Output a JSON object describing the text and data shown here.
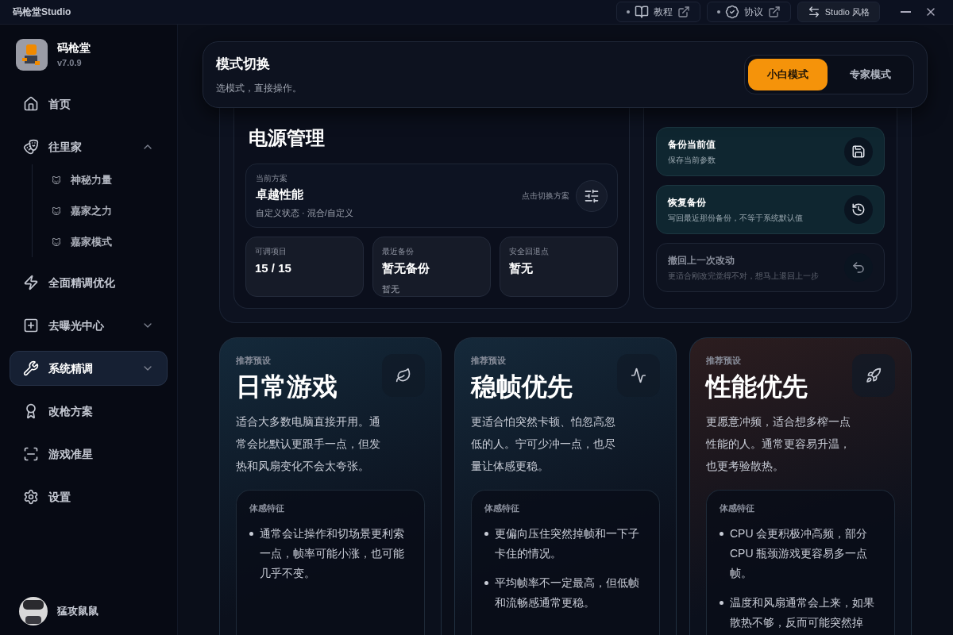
{
  "titlebar": {
    "title": "码枪堂Studio",
    "links": [
      {
        "label": "教程"
      },
      {
        "label": "协议"
      }
    ],
    "style_button": {
      "label": "Studio 风格"
    }
  },
  "sidebar": {
    "brand": {
      "name": "码枪堂",
      "version": "v7.0.9"
    },
    "items": [
      {
        "label": "首页",
        "selected": false
      },
      {
        "label": "往里家",
        "selected": false,
        "expanded": true,
        "children": [
          {
            "label": "神秘力量"
          },
          {
            "label": "嘉家之力"
          },
          {
            "label": "嘉家模式"
          }
        ]
      },
      {
        "label": "全面精调优化",
        "selected": false
      },
      {
        "label": "去曝光中心",
        "selected": false,
        "expanded": false
      },
      {
        "label": "系统精调",
        "selected": true,
        "expanded": false
      },
      {
        "label": "改枪方案",
        "selected": false
      },
      {
        "label": "游戏准星",
        "selected": false
      },
      {
        "label": "设置",
        "selected": false
      }
    ],
    "user": {
      "name": "猛攻鼠鼠"
    }
  },
  "mode_switch": {
    "title": "模式切换",
    "subtitle": "选模式，直接操作。",
    "options": [
      {
        "label": "小白模式",
        "selected": true
      },
      {
        "label": "专家模式",
        "selected": false
      }
    ]
  },
  "power": {
    "title": "电源管理",
    "current_plan": {
      "label": "当前方案",
      "name": "卓越性能",
      "detail": "自定义状态 · 混合/自定义",
      "hint": "点击切换方案"
    },
    "stats": [
      {
        "label": "可调项目",
        "value": "15 / 15"
      },
      {
        "label": "最近备份",
        "value": "暂无备份",
        "note": "暂无"
      },
      {
        "label": "安全回退点",
        "value": "暂无"
      }
    ],
    "actions": [
      {
        "title": "备份当前值",
        "desc": "保存当前参数",
        "disabled": false
      },
      {
        "title": "恢复备份",
        "desc": "写回最近那份备份，不等于系统默认值",
        "disabled": false
      },
      {
        "title": "撤回上一次改动",
        "desc": "更适合刚改完觉得不对，想马上退回上一步",
        "disabled": true
      }
    ]
  },
  "presets": [
    {
      "tag": "推荐预设",
      "title": "日常游戏",
      "color": "#14293a",
      "desc": "适合大多数电脑直接开用。通常会比默认更跟手一点，但发热和风扇变化不会太夸张。",
      "features_label": "体感特征",
      "features": [
        "通常会让操作和切场景更利索一点，帧率可能小涨，也可能几乎不变。"
      ]
    },
    {
      "tag": "推荐预设",
      "title": "稳帧优先",
      "color": "#15293a",
      "desc": "更适合怕突然卡顿、怕忽高忽低的人。宁可少冲一点，也尽量让体感更稳。",
      "features_label": "体感特征",
      "features": [
        "更偏向压住突然掉帧和一下子卡住的情况。",
        "平均帧率不一定最高，但低帧和流畅感通常更稳。"
      ]
    },
    {
      "tag": "推荐预设",
      "title": "性能优先",
      "color": "#2c1d1f",
      "desc": "更愿意冲频，适合想多榨一点性能的人。通常更容易升温，也更考验散热。",
      "features_label": "体感特征",
      "features": [
        "CPU 会更积极冲高频，部分 CPU 瓶颈游戏更容易多一点帧。",
        "温度和风扇通常会上来，如果散热不够，反而可能突然掉"
      ]
    }
  ]
}
